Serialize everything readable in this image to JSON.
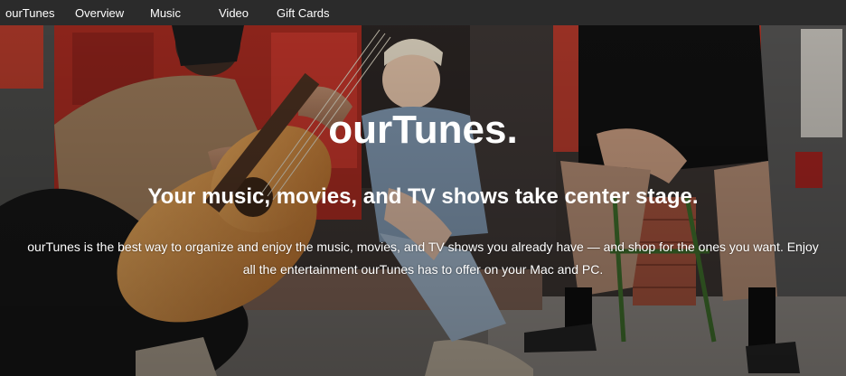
{
  "nav": {
    "brand": "ourTunes",
    "items": [
      "Overview",
      "Music",
      "Video",
      "Gift Cards"
    ]
  },
  "hero": {
    "title": "ourTunes.",
    "subtitle": "Your music, movies, and TV shows take center stage.",
    "description": "ourTunes is the best way to organize and enjoy the music, movies, and TV shows you already have — and shop for the ones you want. Enjoy all the entertainment ourTunes has to offer on your Mac and PC.",
    "image": "photo of three people sitting on a street step, one playing an acoustic guitar"
  },
  "colors": {
    "nav_bg": "#2b2b2b",
    "nav_text": "#ffffff",
    "hero_text": "#ffffff"
  }
}
